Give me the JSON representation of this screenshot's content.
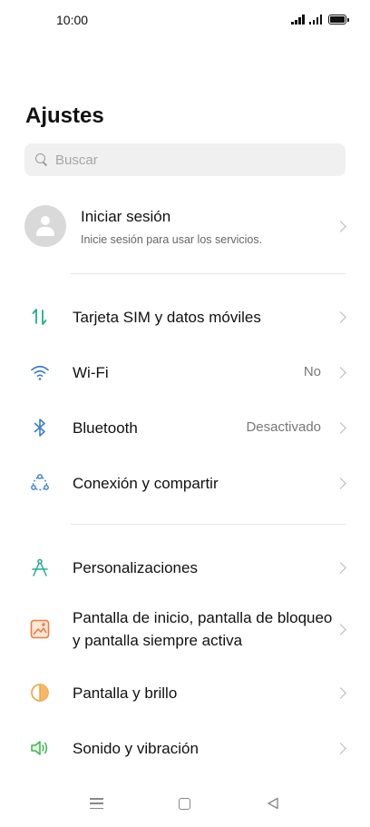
{
  "status_bar": {
    "time": "10:00"
  },
  "header": {
    "title": "Ajustes"
  },
  "search": {
    "placeholder": "Buscar"
  },
  "account": {
    "title": "Iniciar sesión",
    "subtitle": "Inicie sesión para usar los servicios."
  },
  "settings": [
    {
      "label": "Tarjeta SIM y datos móviles",
      "value": "",
      "icon": "sim-data-icon",
      "color": "#1fae8e"
    },
    {
      "label": "Wi-Fi",
      "value": "No",
      "icon": "wifi-icon",
      "color": "#3a7bd5"
    },
    {
      "label": "Bluetooth",
      "value": "Desactivado",
      "icon": "bluetooth-icon",
      "color": "#3a7bd5"
    },
    {
      "label": "Conexión y compartir",
      "value": "",
      "icon": "connection-share-icon",
      "color": "#3a7bd5"
    },
    {
      "label": "Personalizaciones",
      "value": "",
      "icon": "personalization-icon",
      "color": "#1fae8e"
    },
    {
      "label": "Pantalla de inicio, pantalla de bloqueo y pantalla siempre activa",
      "value": "",
      "icon": "home-lock-screen-icon",
      "color": "#f07a3a"
    },
    {
      "label": "Pantalla y brillo",
      "value": "",
      "icon": "display-brightness-icon",
      "color": "#f0a23a"
    },
    {
      "label": "Sonido y vibración",
      "value": "",
      "icon": "sound-vibration-icon",
      "color": "#3cb54a"
    }
  ],
  "nav_bar": {
    "icons": [
      "menu-icon",
      "home-icon",
      "back-icon"
    ]
  }
}
